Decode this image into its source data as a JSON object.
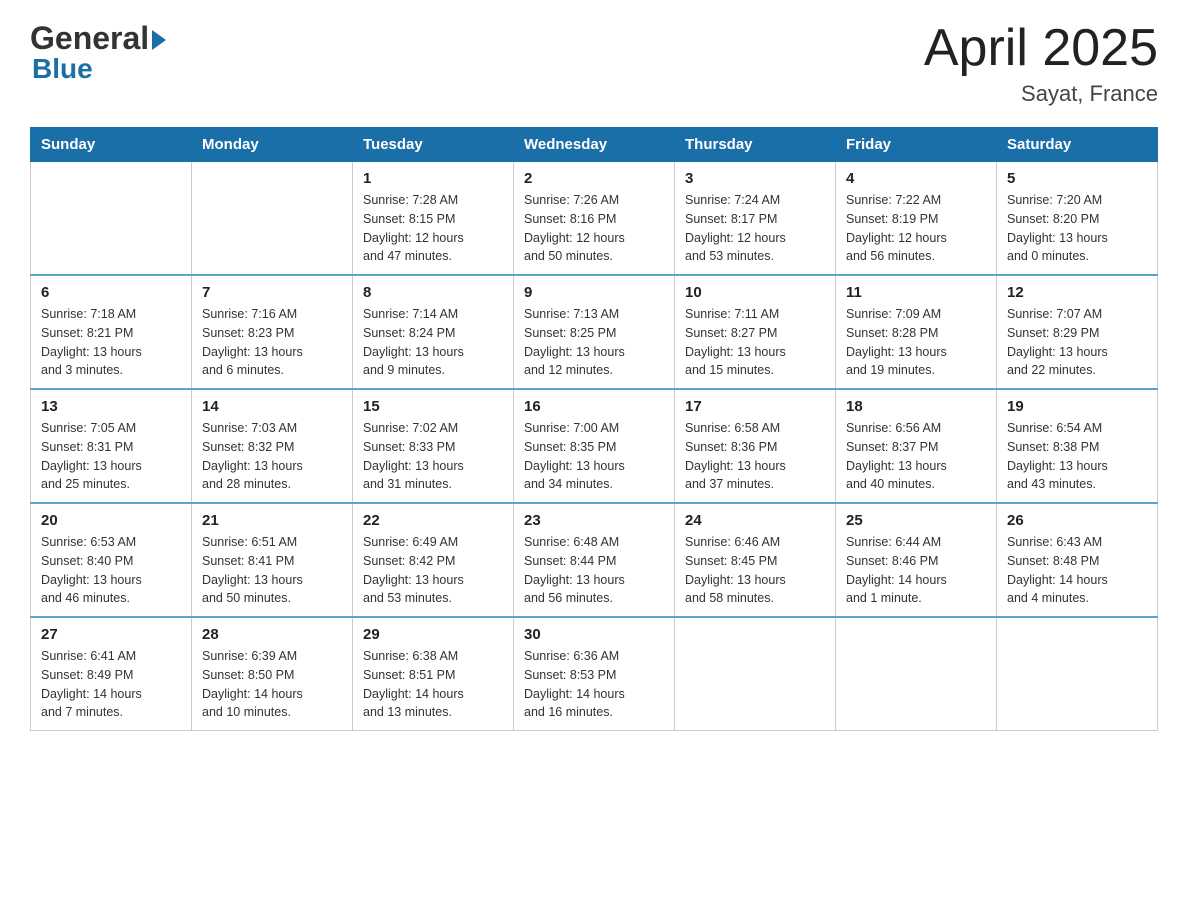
{
  "header": {
    "logo_general": "General",
    "logo_blue": "Blue",
    "month_title": "April 2025",
    "location": "Sayat, France"
  },
  "weekdays": [
    "Sunday",
    "Monday",
    "Tuesday",
    "Wednesday",
    "Thursday",
    "Friday",
    "Saturday"
  ],
  "weeks": [
    [
      {
        "day": "",
        "info": ""
      },
      {
        "day": "",
        "info": ""
      },
      {
        "day": "1",
        "info": "Sunrise: 7:28 AM\nSunset: 8:15 PM\nDaylight: 12 hours\nand 47 minutes."
      },
      {
        "day": "2",
        "info": "Sunrise: 7:26 AM\nSunset: 8:16 PM\nDaylight: 12 hours\nand 50 minutes."
      },
      {
        "day": "3",
        "info": "Sunrise: 7:24 AM\nSunset: 8:17 PM\nDaylight: 12 hours\nand 53 minutes."
      },
      {
        "day": "4",
        "info": "Sunrise: 7:22 AM\nSunset: 8:19 PM\nDaylight: 12 hours\nand 56 minutes."
      },
      {
        "day": "5",
        "info": "Sunrise: 7:20 AM\nSunset: 8:20 PM\nDaylight: 13 hours\nand 0 minutes."
      }
    ],
    [
      {
        "day": "6",
        "info": "Sunrise: 7:18 AM\nSunset: 8:21 PM\nDaylight: 13 hours\nand 3 minutes."
      },
      {
        "day": "7",
        "info": "Sunrise: 7:16 AM\nSunset: 8:23 PM\nDaylight: 13 hours\nand 6 minutes."
      },
      {
        "day": "8",
        "info": "Sunrise: 7:14 AM\nSunset: 8:24 PM\nDaylight: 13 hours\nand 9 minutes."
      },
      {
        "day": "9",
        "info": "Sunrise: 7:13 AM\nSunset: 8:25 PM\nDaylight: 13 hours\nand 12 minutes."
      },
      {
        "day": "10",
        "info": "Sunrise: 7:11 AM\nSunset: 8:27 PM\nDaylight: 13 hours\nand 15 minutes."
      },
      {
        "day": "11",
        "info": "Sunrise: 7:09 AM\nSunset: 8:28 PM\nDaylight: 13 hours\nand 19 minutes."
      },
      {
        "day": "12",
        "info": "Sunrise: 7:07 AM\nSunset: 8:29 PM\nDaylight: 13 hours\nand 22 minutes."
      }
    ],
    [
      {
        "day": "13",
        "info": "Sunrise: 7:05 AM\nSunset: 8:31 PM\nDaylight: 13 hours\nand 25 minutes."
      },
      {
        "day": "14",
        "info": "Sunrise: 7:03 AM\nSunset: 8:32 PM\nDaylight: 13 hours\nand 28 minutes."
      },
      {
        "day": "15",
        "info": "Sunrise: 7:02 AM\nSunset: 8:33 PM\nDaylight: 13 hours\nand 31 minutes."
      },
      {
        "day": "16",
        "info": "Sunrise: 7:00 AM\nSunset: 8:35 PM\nDaylight: 13 hours\nand 34 minutes."
      },
      {
        "day": "17",
        "info": "Sunrise: 6:58 AM\nSunset: 8:36 PM\nDaylight: 13 hours\nand 37 minutes."
      },
      {
        "day": "18",
        "info": "Sunrise: 6:56 AM\nSunset: 8:37 PM\nDaylight: 13 hours\nand 40 minutes."
      },
      {
        "day": "19",
        "info": "Sunrise: 6:54 AM\nSunset: 8:38 PM\nDaylight: 13 hours\nand 43 minutes."
      }
    ],
    [
      {
        "day": "20",
        "info": "Sunrise: 6:53 AM\nSunset: 8:40 PM\nDaylight: 13 hours\nand 46 minutes."
      },
      {
        "day": "21",
        "info": "Sunrise: 6:51 AM\nSunset: 8:41 PM\nDaylight: 13 hours\nand 50 minutes."
      },
      {
        "day": "22",
        "info": "Sunrise: 6:49 AM\nSunset: 8:42 PM\nDaylight: 13 hours\nand 53 minutes."
      },
      {
        "day": "23",
        "info": "Sunrise: 6:48 AM\nSunset: 8:44 PM\nDaylight: 13 hours\nand 56 minutes."
      },
      {
        "day": "24",
        "info": "Sunrise: 6:46 AM\nSunset: 8:45 PM\nDaylight: 13 hours\nand 58 minutes."
      },
      {
        "day": "25",
        "info": "Sunrise: 6:44 AM\nSunset: 8:46 PM\nDaylight: 14 hours\nand 1 minute."
      },
      {
        "day": "26",
        "info": "Sunrise: 6:43 AM\nSunset: 8:48 PM\nDaylight: 14 hours\nand 4 minutes."
      }
    ],
    [
      {
        "day": "27",
        "info": "Sunrise: 6:41 AM\nSunset: 8:49 PM\nDaylight: 14 hours\nand 7 minutes."
      },
      {
        "day": "28",
        "info": "Sunrise: 6:39 AM\nSunset: 8:50 PM\nDaylight: 14 hours\nand 10 minutes."
      },
      {
        "day": "29",
        "info": "Sunrise: 6:38 AM\nSunset: 8:51 PM\nDaylight: 14 hours\nand 13 minutes."
      },
      {
        "day": "30",
        "info": "Sunrise: 6:36 AM\nSunset: 8:53 PM\nDaylight: 14 hours\nand 16 minutes."
      },
      {
        "day": "",
        "info": ""
      },
      {
        "day": "",
        "info": ""
      },
      {
        "day": "",
        "info": ""
      }
    ]
  ]
}
